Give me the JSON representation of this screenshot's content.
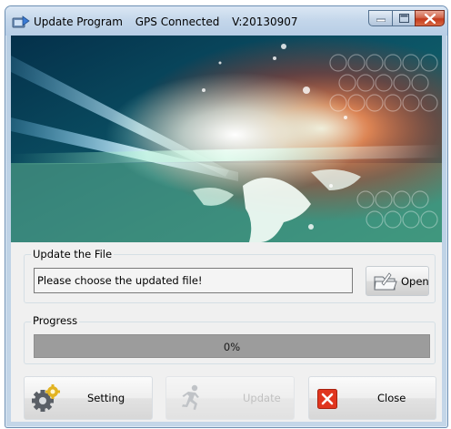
{
  "window": {
    "title_app": "Update Program",
    "title_status": "GPS Connected",
    "title_version": "V:20130907"
  },
  "file_group": {
    "label": "Update the File",
    "file_value": "Please choose the updated file!",
    "open_label": "Open"
  },
  "progress_group": {
    "label": "Progress",
    "value_text": "0%",
    "value": 0
  },
  "buttons": {
    "setting_label": "Setting",
    "update_label": "Update",
    "close_label": "Close"
  },
  "icons": {
    "app": "update-program-icon",
    "minimize": "minimize-icon",
    "maximize": "maximize-icon",
    "close_window": "close-icon",
    "open": "open-file-icon",
    "setting": "settings-gear-icon",
    "update": "running-man-icon",
    "close": "close-x-icon"
  },
  "colors": {
    "close_red": "#e0351e",
    "gear_gold": "#e2b321",
    "progress_fill": "#3fa64a"
  }
}
